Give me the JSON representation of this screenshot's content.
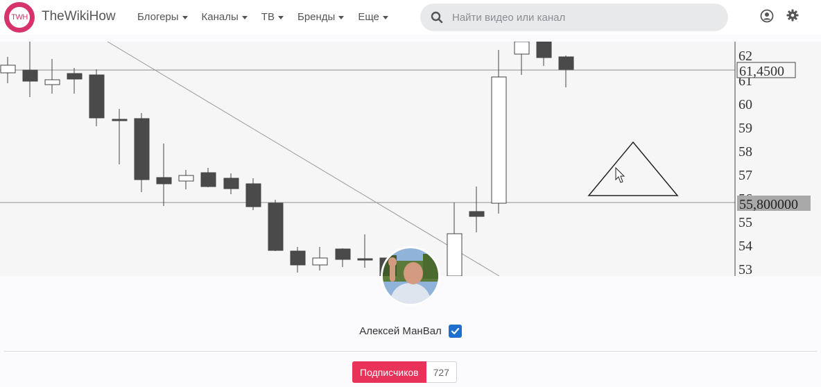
{
  "site": {
    "logo_text": "TWH",
    "brand": "TheWikiHow"
  },
  "nav": {
    "items": [
      {
        "label": "Блогеры"
      },
      {
        "label": "Каналы"
      },
      {
        "label": "ТВ"
      },
      {
        "label": "Бренды"
      },
      {
        "label": "Еще"
      }
    ]
  },
  "search": {
    "placeholder": "Найти видео или канал",
    "value": ""
  },
  "header_icons": [
    "user-icon",
    "gear-icon"
  ],
  "cover": {
    "price_axis": [
      "62",
      "61",
      "60",
      "59",
      "58",
      "57",
      "56",
      "55",
      "54",
      "53"
    ],
    "price_label_top": "61,4500",
    "price_label_bottom": "55,800000"
  },
  "channel": {
    "name": "Алексей МанВал",
    "verified": true,
    "subscribe_label": "Подписчиков",
    "subscribers": "727"
  },
  "colors": {
    "brand": "#d6336c",
    "subscribe": "#e8325a",
    "verified": "#1f6fd1"
  }
}
